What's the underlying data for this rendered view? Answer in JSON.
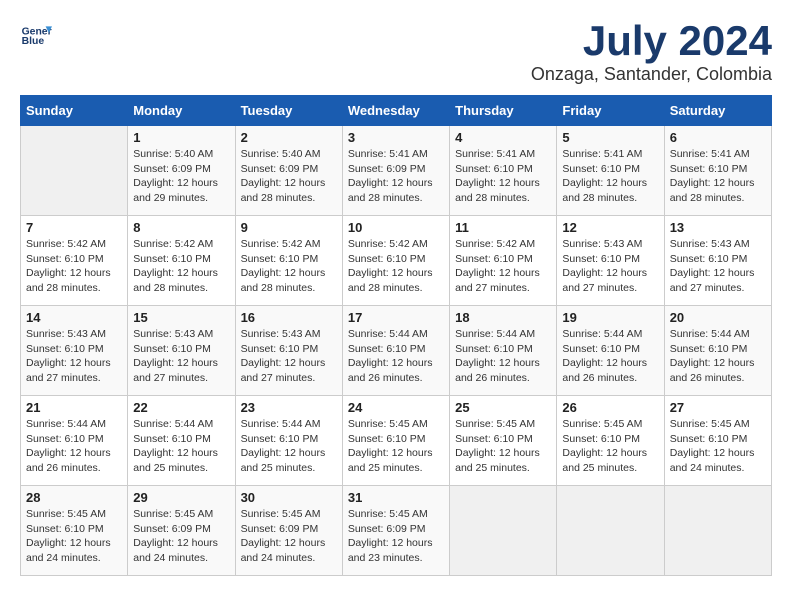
{
  "header": {
    "logo_line1": "General",
    "logo_line2": "Blue",
    "month_year": "July 2024",
    "location": "Onzaga, Santander, Colombia"
  },
  "calendar": {
    "days_of_week": [
      "Sunday",
      "Monday",
      "Tuesday",
      "Wednesday",
      "Thursday",
      "Friday",
      "Saturday"
    ],
    "weeks": [
      [
        {
          "num": "",
          "info": ""
        },
        {
          "num": "1",
          "info": "Sunrise: 5:40 AM\nSunset: 6:09 PM\nDaylight: 12 hours\nand 29 minutes."
        },
        {
          "num": "2",
          "info": "Sunrise: 5:40 AM\nSunset: 6:09 PM\nDaylight: 12 hours\nand 28 minutes."
        },
        {
          "num": "3",
          "info": "Sunrise: 5:41 AM\nSunset: 6:09 PM\nDaylight: 12 hours\nand 28 minutes."
        },
        {
          "num": "4",
          "info": "Sunrise: 5:41 AM\nSunset: 6:10 PM\nDaylight: 12 hours\nand 28 minutes."
        },
        {
          "num": "5",
          "info": "Sunrise: 5:41 AM\nSunset: 6:10 PM\nDaylight: 12 hours\nand 28 minutes."
        },
        {
          "num": "6",
          "info": "Sunrise: 5:41 AM\nSunset: 6:10 PM\nDaylight: 12 hours\nand 28 minutes."
        }
      ],
      [
        {
          "num": "7",
          "info": "Sunrise: 5:42 AM\nSunset: 6:10 PM\nDaylight: 12 hours\nand 28 minutes."
        },
        {
          "num": "8",
          "info": "Sunrise: 5:42 AM\nSunset: 6:10 PM\nDaylight: 12 hours\nand 28 minutes."
        },
        {
          "num": "9",
          "info": "Sunrise: 5:42 AM\nSunset: 6:10 PM\nDaylight: 12 hours\nand 28 minutes."
        },
        {
          "num": "10",
          "info": "Sunrise: 5:42 AM\nSunset: 6:10 PM\nDaylight: 12 hours\nand 28 minutes."
        },
        {
          "num": "11",
          "info": "Sunrise: 5:42 AM\nSunset: 6:10 PM\nDaylight: 12 hours\nand 27 minutes."
        },
        {
          "num": "12",
          "info": "Sunrise: 5:43 AM\nSunset: 6:10 PM\nDaylight: 12 hours\nand 27 minutes."
        },
        {
          "num": "13",
          "info": "Sunrise: 5:43 AM\nSunset: 6:10 PM\nDaylight: 12 hours\nand 27 minutes."
        }
      ],
      [
        {
          "num": "14",
          "info": "Sunrise: 5:43 AM\nSunset: 6:10 PM\nDaylight: 12 hours\nand 27 minutes."
        },
        {
          "num": "15",
          "info": "Sunrise: 5:43 AM\nSunset: 6:10 PM\nDaylight: 12 hours\nand 27 minutes."
        },
        {
          "num": "16",
          "info": "Sunrise: 5:43 AM\nSunset: 6:10 PM\nDaylight: 12 hours\nand 27 minutes."
        },
        {
          "num": "17",
          "info": "Sunrise: 5:44 AM\nSunset: 6:10 PM\nDaylight: 12 hours\nand 26 minutes."
        },
        {
          "num": "18",
          "info": "Sunrise: 5:44 AM\nSunset: 6:10 PM\nDaylight: 12 hours\nand 26 minutes."
        },
        {
          "num": "19",
          "info": "Sunrise: 5:44 AM\nSunset: 6:10 PM\nDaylight: 12 hours\nand 26 minutes."
        },
        {
          "num": "20",
          "info": "Sunrise: 5:44 AM\nSunset: 6:10 PM\nDaylight: 12 hours\nand 26 minutes."
        }
      ],
      [
        {
          "num": "21",
          "info": "Sunrise: 5:44 AM\nSunset: 6:10 PM\nDaylight: 12 hours\nand 26 minutes."
        },
        {
          "num": "22",
          "info": "Sunrise: 5:44 AM\nSunset: 6:10 PM\nDaylight: 12 hours\nand 25 minutes."
        },
        {
          "num": "23",
          "info": "Sunrise: 5:44 AM\nSunset: 6:10 PM\nDaylight: 12 hours\nand 25 minutes."
        },
        {
          "num": "24",
          "info": "Sunrise: 5:45 AM\nSunset: 6:10 PM\nDaylight: 12 hours\nand 25 minutes."
        },
        {
          "num": "25",
          "info": "Sunrise: 5:45 AM\nSunset: 6:10 PM\nDaylight: 12 hours\nand 25 minutes."
        },
        {
          "num": "26",
          "info": "Sunrise: 5:45 AM\nSunset: 6:10 PM\nDaylight: 12 hours\nand 25 minutes."
        },
        {
          "num": "27",
          "info": "Sunrise: 5:45 AM\nSunset: 6:10 PM\nDaylight: 12 hours\nand 24 minutes."
        }
      ],
      [
        {
          "num": "28",
          "info": "Sunrise: 5:45 AM\nSunset: 6:10 PM\nDaylight: 12 hours\nand 24 minutes."
        },
        {
          "num": "29",
          "info": "Sunrise: 5:45 AM\nSunset: 6:09 PM\nDaylight: 12 hours\nand 24 minutes."
        },
        {
          "num": "30",
          "info": "Sunrise: 5:45 AM\nSunset: 6:09 PM\nDaylight: 12 hours\nand 24 minutes."
        },
        {
          "num": "31",
          "info": "Sunrise: 5:45 AM\nSunset: 6:09 PM\nDaylight: 12 hours\nand 23 minutes."
        },
        {
          "num": "",
          "info": ""
        },
        {
          "num": "",
          "info": ""
        },
        {
          "num": "",
          "info": ""
        }
      ]
    ]
  }
}
